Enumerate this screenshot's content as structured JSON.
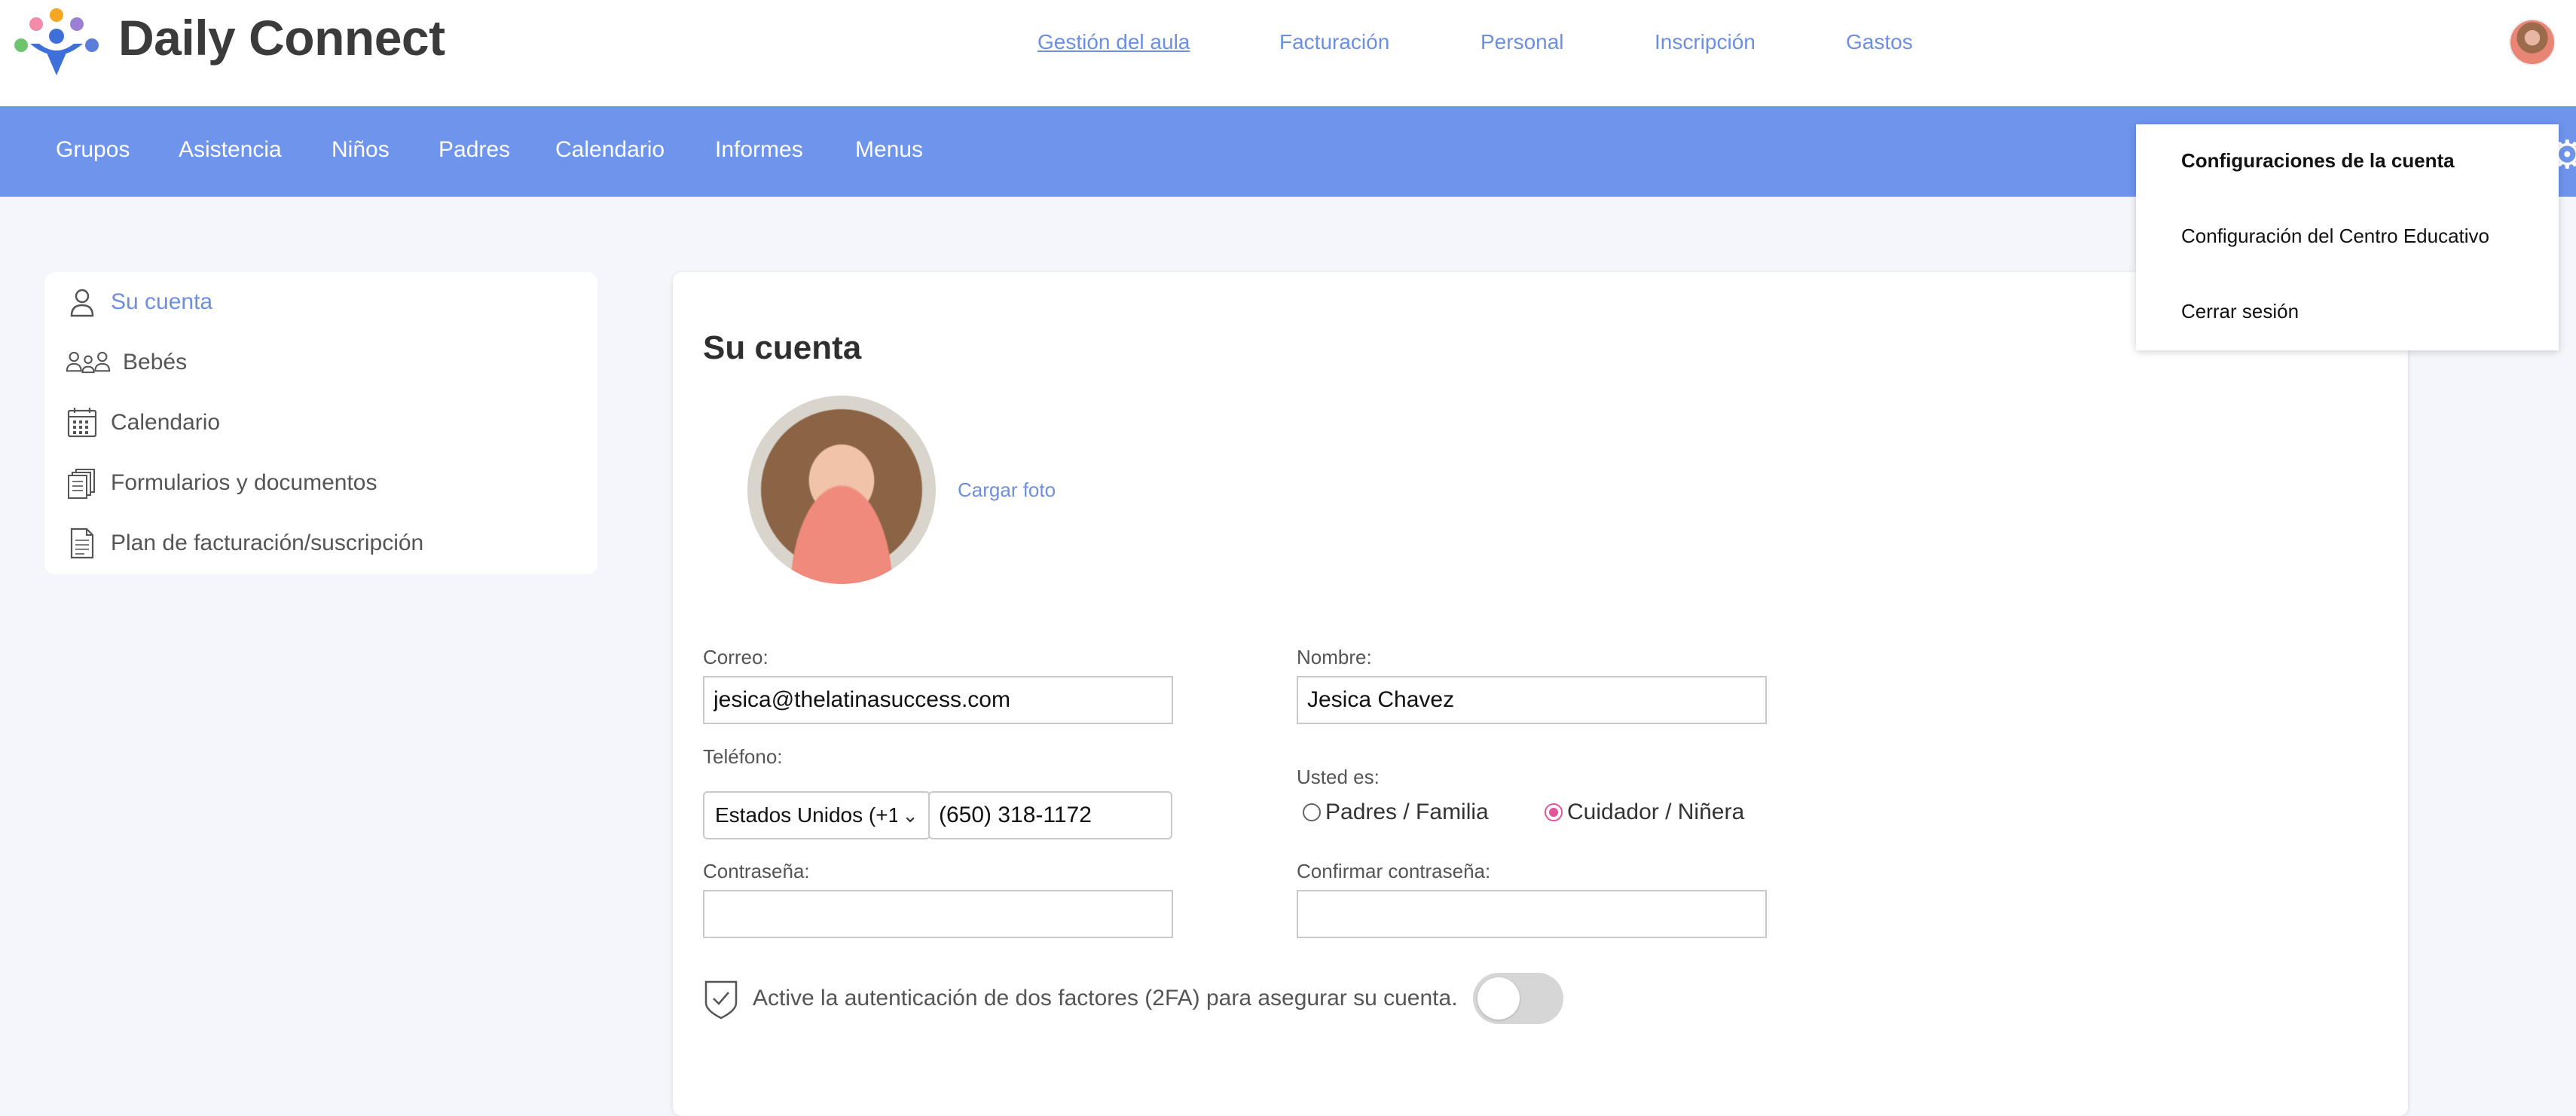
{
  "app": {
    "name": "Daily Connect"
  },
  "top_nav": [
    {
      "label": "Gestión del aula",
      "active": true
    },
    {
      "label": "Facturación",
      "active": false
    },
    {
      "label": "Personal",
      "active": false
    },
    {
      "label": "Inscripción",
      "active": false
    },
    {
      "label": "Gastos",
      "active": false
    }
  ],
  "main_nav": [
    "Grupos",
    "Asistencia",
    "Niños",
    "Padres",
    "Calendario",
    "Informes",
    "Menus"
  ],
  "sidebar": {
    "items": [
      {
        "label": "Su cuenta",
        "icon": "user-icon",
        "active": true
      },
      {
        "label": "Bebés",
        "icon": "people-icon",
        "active": false
      },
      {
        "label": "Calendario",
        "icon": "calendar-icon",
        "active": false
      },
      {
        "label": "Formularios y documentos",
        "icon": "documents-icon",
        "active": false
      },
      {
        "label": "Plan de facturación/suscripción",
        "icon": "document-icon",
        "active": false
      }
    ]
  },
  "account": {
    "title": "Su cuenta",
    "upload_photo": "Cargar foto",
    "email": {
      "label": "Correo:",
      "value": "jesica@thelatinasuccess.com"
    },
    "name": {
      "label": "Nombre:",
      "value": "Jesica Chavez"
    },
    "phone": {
      "label": "Teléfono:",
      "country": "Estados Unidos (+1",
      "value": "(650) 318-1172"
    },
    "role": {
      "label": "Usted es:",
      "options": [
        {
          "label": "Padres / Familia",
          "checked": false
        },
        {
          "label": "Cuidador / Niñera",
          "checked": true
        }
      ]
    },
    "password": {
      "label": "Contraseña:",
      "value": ""
    },
    "confirm_password": {
      "label": "Confirmar contraseña:",
      "value": ""
    },
    "twofa": {
      "text": "Active la autenticación de dos factores (2FA) para asegurar su cuenta.",
      "enabled": false
    }
  },
  "user_menu": {
    "items": [
      {
        "label": "Configuraciones de la cuenta",
        "bold": true
      },
      {
        "label": "Configuración del Centro Educativo",
        "bold": false
      },
      {
        "label": "Cerrar sesión",
        "bold": false
      }
    ]
  },
  "colors": {
    "accent": "#6f94ec",
    "link": "#6e8fe0",
    "radio_selected": "#e2559a"
  }
}
